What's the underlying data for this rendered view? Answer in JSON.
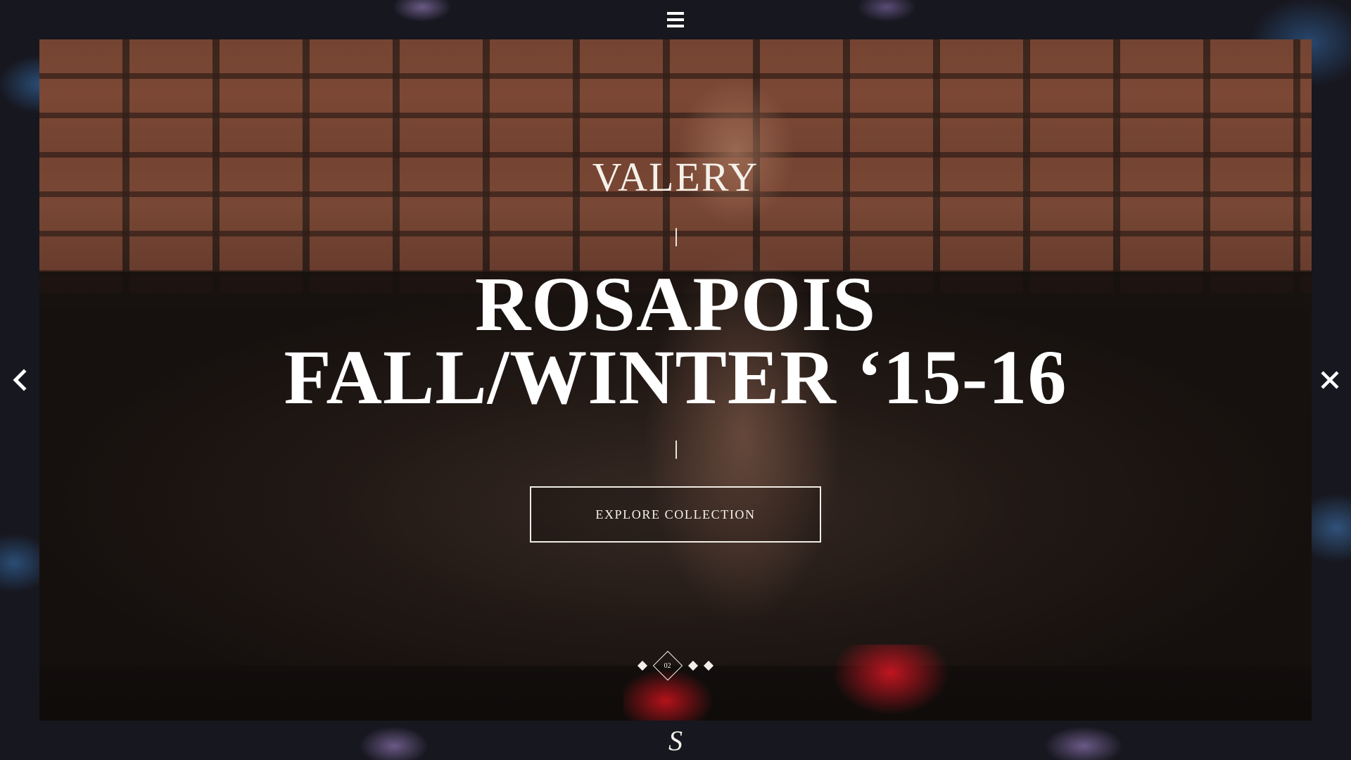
{
  "header": {
    "menu_icon": "hamburger-menu-icon"
  },
  "hero": {
    "brand_logo": "VALERY",
    "headline_line1": "ROSAPOIS",
    "headline_line2": "FALL/WINTER ‘15-16",
    "cta_label": "EXPLORE COLLECTION"
  },
  "navigation": {
    "prev_icon": "chevron-left-icon",
    "close_icon": "close-icon"
  },
  "slider": {
    "current_slide_label": "02",
    "total_dots": 4,
    "active_index": 2
  },
  "footer": {
    "logo_glyph": "S"
  },
  "colors": {
    "background": "#17171f",
    "text": "#ffffff",
    "sock_accent": "#c01520"
  }
}
